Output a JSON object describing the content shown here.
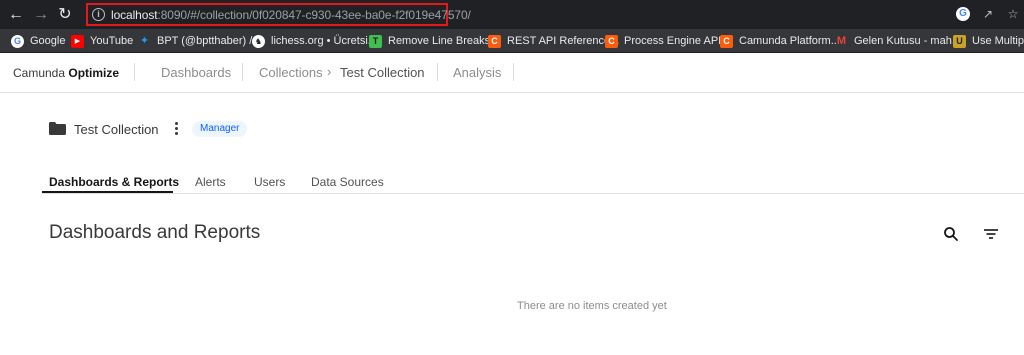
{
  "browser": {
    "url_host": "localhost",
    "url_rest": ":8090/#/collection/0f020847-c930-43ee-ba0e-f2f019e47570/",
    "nav": {
      "back_icon": "back-arrow-icon",
      "forward_icon": "forward-arrow-icon",
      "reload_icon": "reload-icon"
    },
    "bookmarks": [
      {
        "label": "Google",
        "icon": "google-icon",
        "color": "#ffffff"
      },
      {
        "label": "YouTube",
        "icon": "youtube-icon",
        "color": "#ff0000"
      },
      {
        "label": "BPT (@bptthaber) /...",
        "icon": "twitter-icon",
        "color": "#1d9bf0"
      },
      {
        "label": "lichess.org • Ücretsi...",
        "icon": "lichess-icon",
        "color": "#ffffff"
      },
      {
        "label": "Remove Line Breaks...",
        "icon": "remove-line-breaks-icon",
        "color": "#3fbf4f"
      },
      {
        "label": "REST API Reference...",
        "icon": "camunda-icon",
        "color": "#fc5d0d"
      },
      {
        "label": "Process Engine API...",
        "icon": "camunda-icon",
        "color": "#fc5d0d"
      },
      {
        "label": "Camunda Platform...",
        "icon": "camunda-icon",
        "color": "#fc5d0d"
      },
      {
        "label": "Gelen Kutusu - mah...",
        "icon": "gmail-icon",
        "color": "#ea4335"
      },
      {
        "label": "Use Multiple",
        "icon": "bookmark-icon",
        "color": "#c9a227"
      }
    ]
  },
  "app": {
    "brand_prefix": "Camunda",
    "brand_name": "Optimize",
    "nav": {
      "dashboards": "Dashboards",
      "collections": "Collections",
      "separator": "›",
      "current": "Test Collection",
      "analysis": "Analysis"
    }
  },
  "collection": {
    "title": "Test Collection",
    "role_badge": "Manager"
  },
  "tabs": [
    {
      "label": "Dashboards & Reports",
      "active": true
    },
    {
      "label": "Alerts",
      "active": false
    },
    {
      "label": "Users",
      "active": false
    },
    {
      "label": "Data Sources",
      "active": false
    }
  ],
  "content": {
    "title": "Dashboards and Reports",
    "empty_message": "There are no items created yet"
  },
  "colors": {
    "chrome": "#202124",
    "bookmark_bar": "#35363a",
    "highlight_border": "#e5191b",
    "badge_bg": "#edf5ff",
    "badge_text": "#0f62fe"
  }
}
